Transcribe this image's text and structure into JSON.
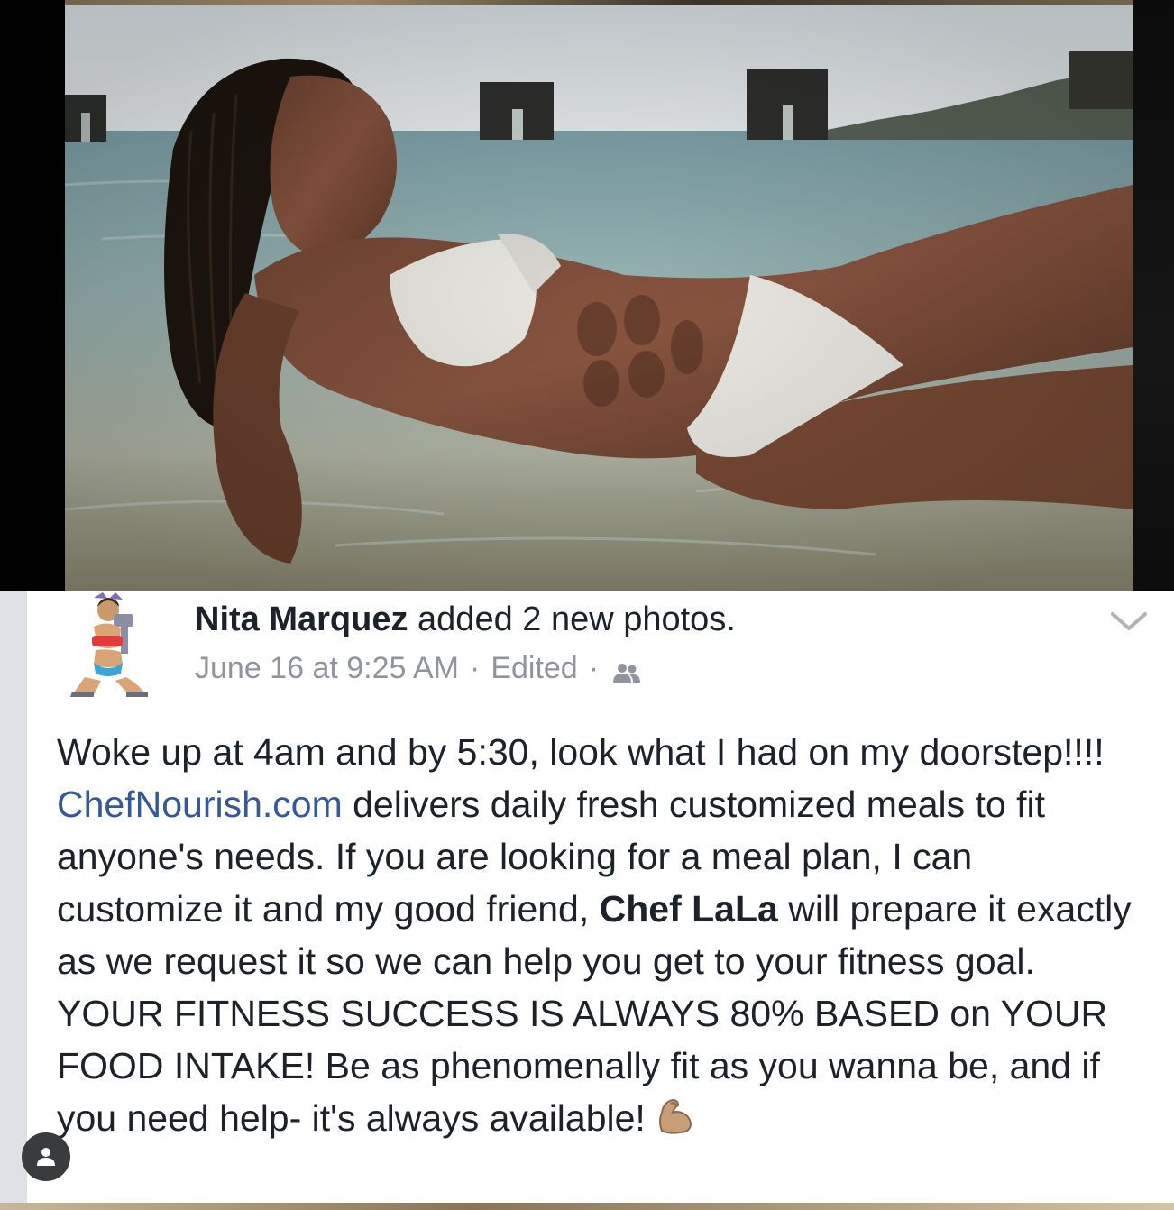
{
  "post": {
    "author": "Nita Marquez",
    "action": " added 2 new photos.",
    "date": "June 16 at 9:25 AM",
    "separator": "·",
    "edited": "Edited",
    "audience_icon": "friends-icon",
    "options_icon": "chevron-down-icon",
    "body": {
      "part1": "Woke up at 4am and by 5:30, look what I had on my doorstep!!!! ",
      "link": "ChefNourish.com",
      "part2": " delivers daily fresh customized meals to fit anyone's needs. If you are looking for a meal plan, I can customize it and my good friend, ",
      "mention": "Chef LaLa",
      "part3": "  will prepare it exactly as we request it so we can help you get to your fitness goal. YOUR FITNESS SUCCESS IS ALWAYS 80% BASED on YOUR FOOD INTAKE! Be as phenomenally fit as you wanna be, and if you need help- it's always available!",
      "emoji": "flexed-biceps-icon"
    }
  },
  "colors": {
    "link": "#365899",
    "text": "#1d2129",
    "meta": "#90949c",
    "background": "#ffffff"
  },
  "overlay": {
    "profile_icon": "person-icon"
  }
}
